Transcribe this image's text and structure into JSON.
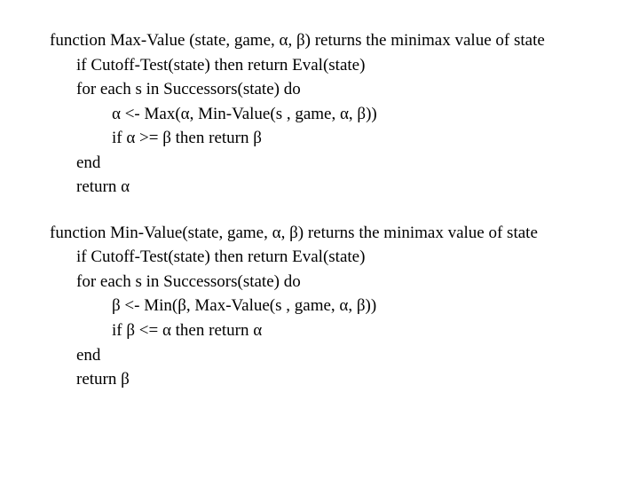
{
  "max": {
    "sig": "function Max-Value (state, game, α, β) returns the minimax value of state",
    "cutoff": "if Cutoff-Test(state) then return Eval(state)",
    "foreach": "for each s in Successors(state) do",
    "assign": "α <- Max(α, Min-Value(s , game, α, β))",
    "test": "if α >= β then return β",
    "end": "end",
    "ret": "return α"
  },
  "min": {
    "sig": "function Min-Value(state, game, α, β) returns the minimax value of state",
    "cutoff": " if Cutoff-Test(state) then return Eval(state)",
    "foreach": "for each s in Successors(state) do",
    "assign": "β <- Min(β, Max-Value(s , game, α, β))",
    "test": "if β <= α then return α",
    "end": "end",
    "ret": "return β"
  }
}
